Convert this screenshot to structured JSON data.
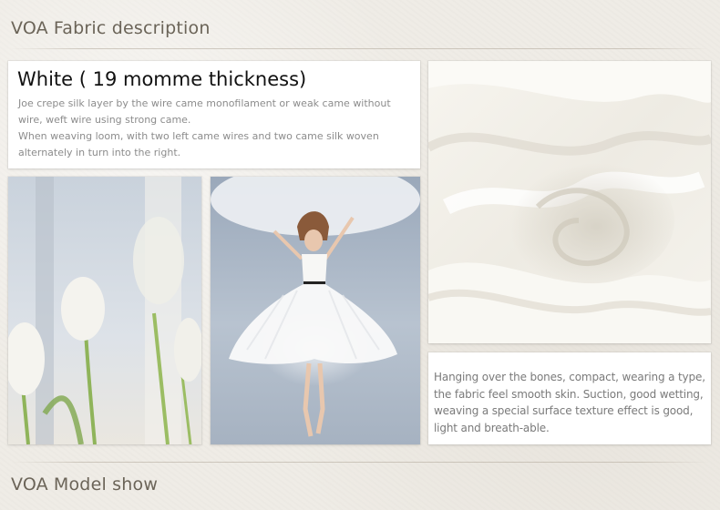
{
  "headings": {
    "fabric": {
      "brand": "VOA",
      "label": "Fabric description"
    },
    "model": {
      "brand": "VOA",
      "label": "Model show"
    }
  },
  "fabric_card": {
    "title": "White ( 19 momme thickness)",
    "paragraphs": [
      "Joe crepe silk layer by the wire came monofilament or weak came without wire, weft wire using strong came.",
      "When weaving loom, with two left came wires and two came silk woven alternately in turn into the right."
    ]
  },
  "feel_card": {
    "text": "Hanging over the bones, compact, wearing a type, the fabric feel smooth skin. Suction, good wetting, weaving a special surface texture effect is good, light and breath-able."
  },
  "images": {
    "tulips": "white tulips photo",
    "model": "model in white dress photo",
    "silk": "white silk fabric photo"
  },
  "colors": {
    "background": "#efece6",
    "heading": "#6b6458",
    "title": "#111111",
    "body": "#8c8c8c"
  }
}
